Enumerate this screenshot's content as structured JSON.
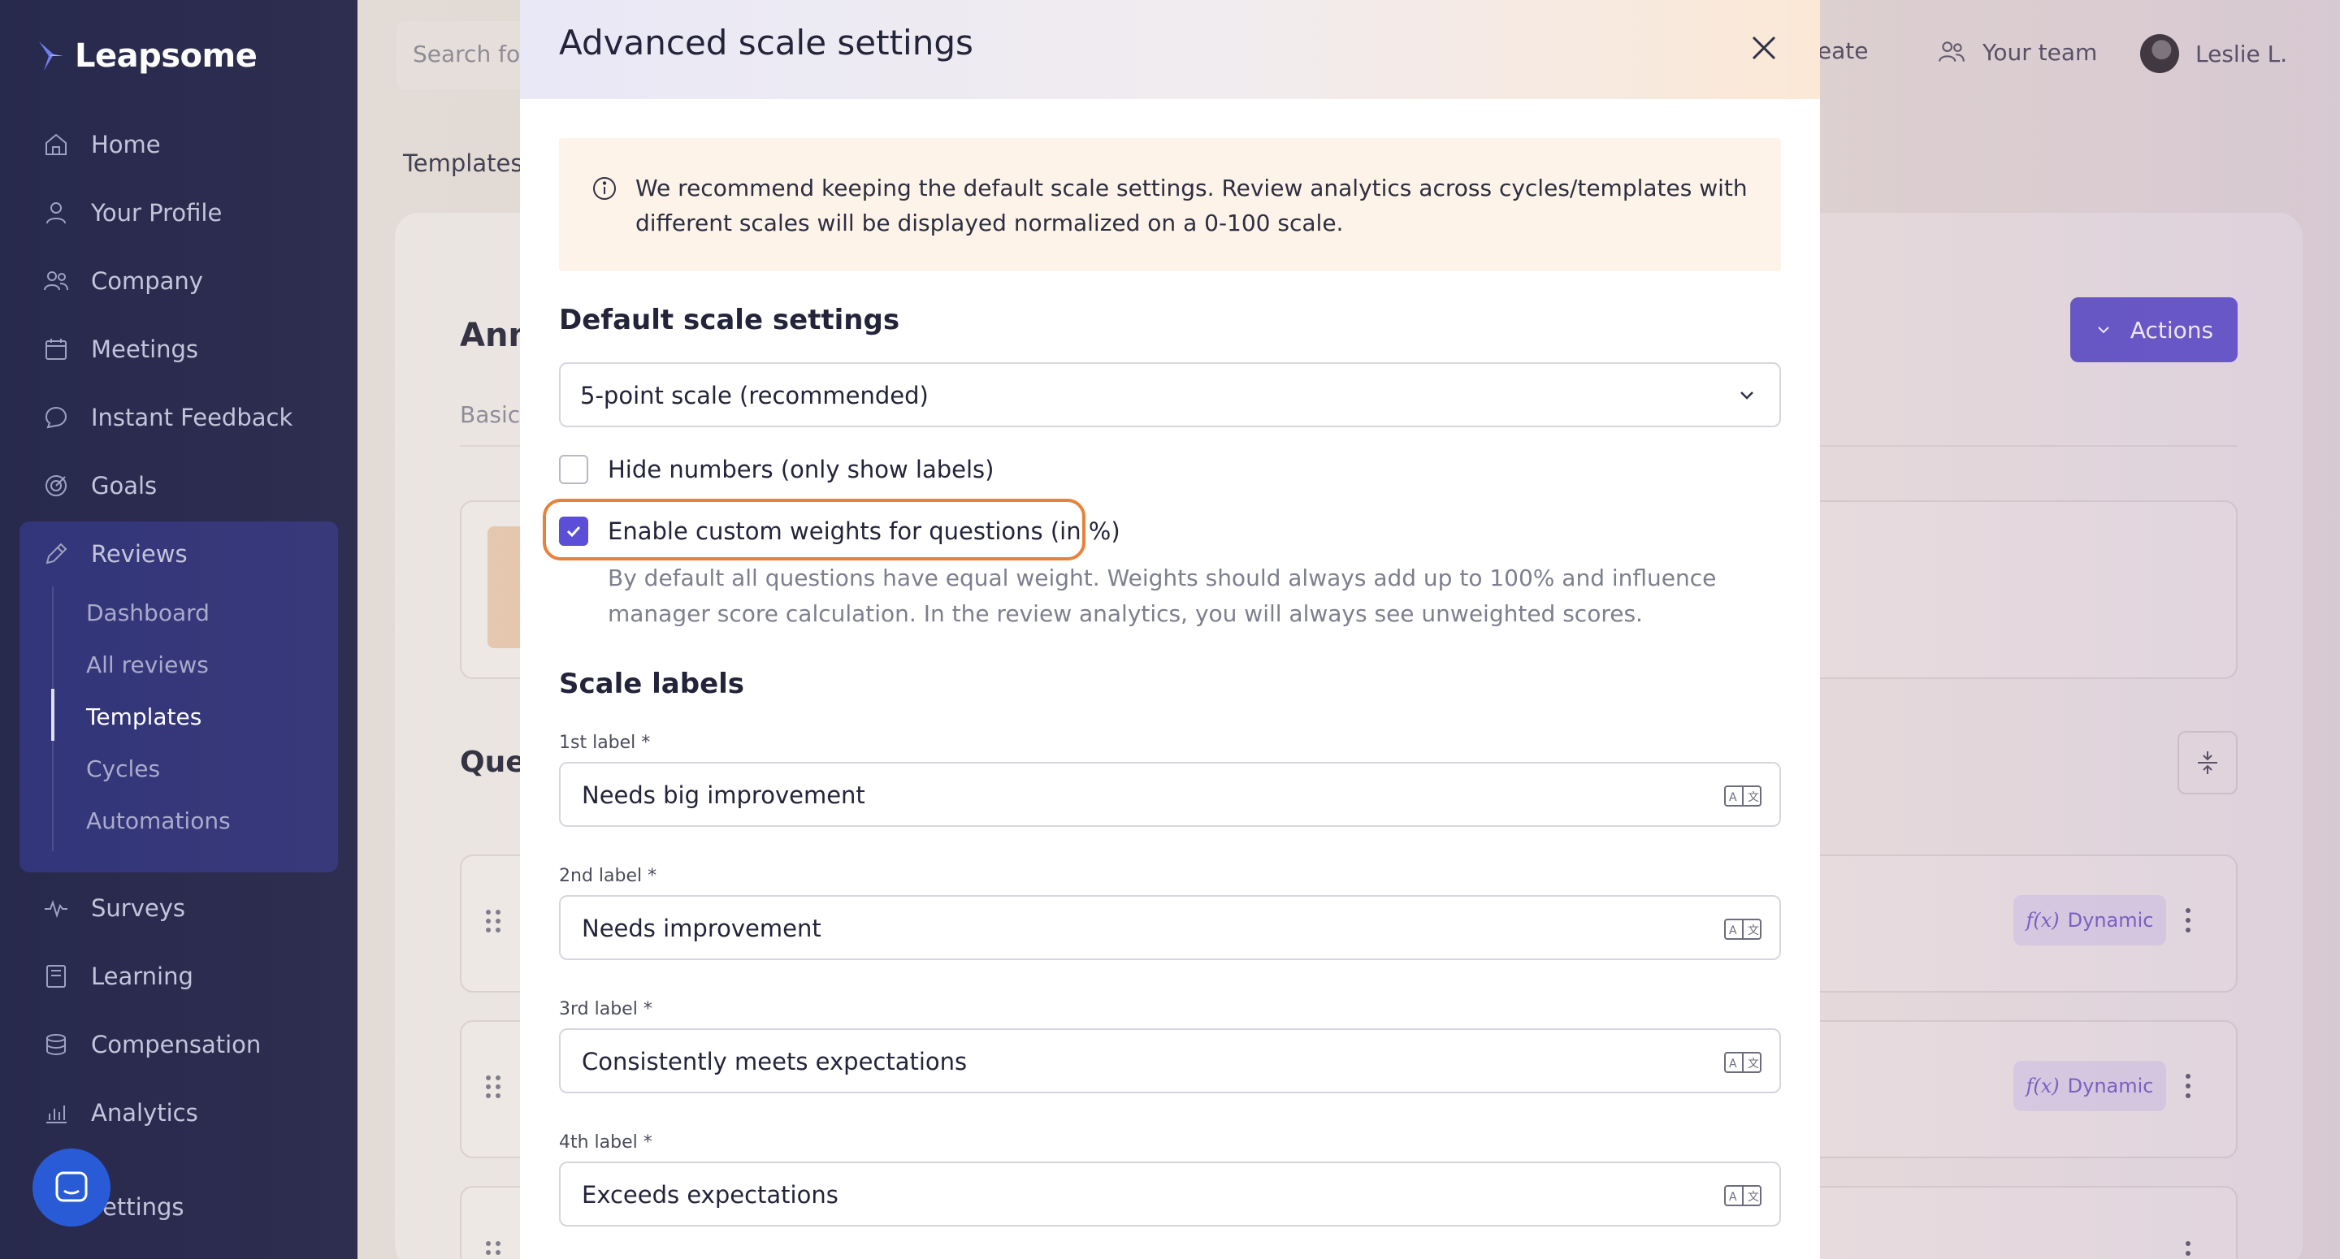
{
  "app": {
    "brand": "Leapsome"
  },
  "sidebar": {
    "items": [
      {
        "label": "Home",
        "icon": "home-icon"
      },
      {
        "label": "Your Profile",
        "icon": "user-icon"
      },
      {
        "label": "Company",
        "icon": "people-icon"
      },
      {
        "label": "Meetings",
        "icon": "calendar-icon"
      },
      {
        "label": "Instant Feedback",
        "icon": "chat-icon"
      },
      {
        "label": "Goals",
        "icon": "target-icon"
      },
      {
        "label": "Reviews",
        "icon": "pencil-icon"
      },
      {
        "label": "Surveys",
        "icon": "pulse-icon"
      },
      {
        "label": "Learning",
        "icon": "book-icon"
      },
      {
        "label": "Compensation",
        "icon": "coins-icon"
      },
      {
        "label": "Analytics",
        "icon": "chart-icon"
      },
      {
        "label": "ettings",
        "icon": "settings-icon"
      }
    ],
    "reviews_sub": [
      "Dashboard",
      "All reviews",
      "Templates",
      "Cycles",
      "Automations"
    ],
    "active_sub": "Templates"
  },
  "header": {
    "search_placeholder": "Search fo",
    "create_label": "reate",
    "team_label": "Your team",
    "user_name": "Leslie L."
  },
  "background": {
    "breadcrumb": "Templates",
    "heading": "Ann",
    "tab": "Basics",
    "actions_label": "Actions",
    "questions_heading": "Ques",
    "dynamic_label": "Dynamic",
    "fx_label": "f(x)"
  },
  "modal": {
    "title": "Advanced scale settings",
    "info_text": "We recommend keeping the default scale settings. Review analytics across cycles/templates with different scales will be displayed normalized on a 0-100 scale.",
    "default_section": "Default scale settings",
    "scale_select": "5-point scale (recommended)",
    "hide_numbers_label": "Hide numbers (only show labels)",
    "hide_numbers_checked": false,
    "custom_weights_label": "Enable custom weights for questions (in %)",
    "custom_weights_checked": true,
    "custom_weights_help": "By default all questions have equal weight. Weights should always add up to 100% and influence manager score calculation. In the review analytics, you will always see unweighted scores.",
    "labels_section": "Scale labels",
    "labels": [
      {
        "label": "1st label *",
        "value": "Needs big improvement"
      },
      {
        "label": "2nd label *",
        "value": "Needs improvement"
      },
      {
        "label": "3rd label *",
        "value": "Consistently meets expectations"
      },
      {
        "label": "4th label *",
        "value": "Exceeds expectations"
      }
    ]
  },
  "colors": {
    "sidebar_bg": "#27294d",
    "accent": "#5a4fd6",
    "highlight_outline": "#e8813a",
    "info_bg": "#fdf3e8"
  }
}
